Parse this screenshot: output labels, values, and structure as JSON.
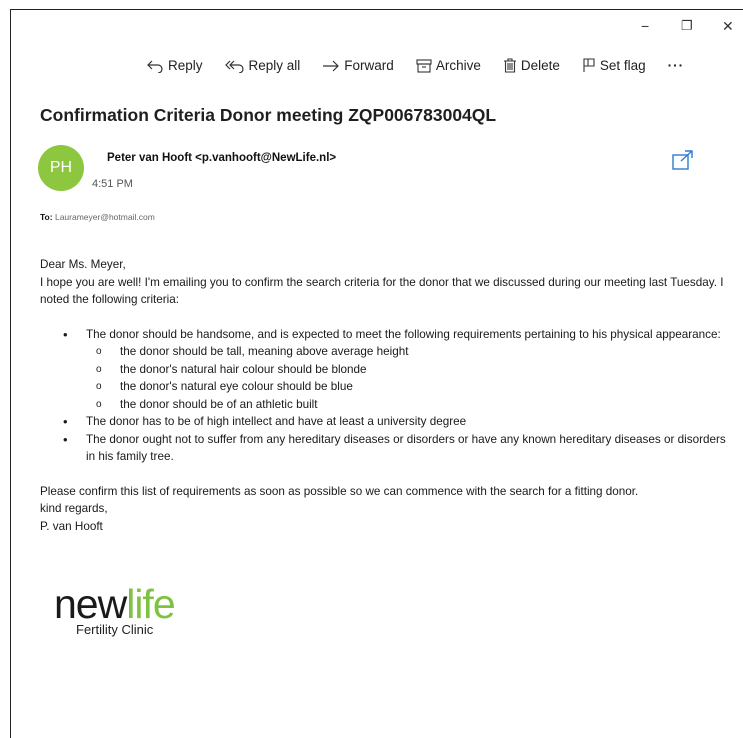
{
  "window_controls": {
    "minimize": "−",
    "restore": "❐",
    "close": "✕"
  },
  "toolbar": {
    "reply": "Reply",
    "reply_all": "Reply all",
    "forward": "Forward",
    "archive": "Archive",
    "delete": "Delete",
    "set_flag": "Set flag",
    "more": "···"
  },
  "email": {
    "subject": "Confirmation Criteria Donor meeting ZQP006783004QL",
    "avatar_initials": "PH",
    "avatar_color": "#8dc63f",
    "sender": "Peter van Hooft <p.vanhooft@NewLife.nl>",
    "time": "4:51 PM",
    "to_label": "To:",
    "to_address": "Laurameyer@hotmail.com",
    "greeting": "Dear Ms. Meyer,",
    "intro": "I hope you are well! I'm emailing you to confirm the search criteria for the donor that we discussed during our meeting last Tuesday. I noted the following criteria:",
    "criteria": [
      "The donor should be handsome, and is expected to meet the following requirements pertaining to his physical appearance:",
      "The donor has to be of high intellect and have at least a university degree",
      "The donor ought not to suffer from any hereditary diseases or disorders or have any known hereditary diseases or disorders in his family tree."
    ],
    "sub_criteria": [
      "the donor should be tall, meaning above average height",
      "the donor's natural hair colour should be blonde",
      "the donor's natural eye colour should be blue",
      "the donor should be of an athletic built"
    ],
    "closing": "Please confirm this list of requirements as soon as possible so we can commence with the search for a fitting donor.",
    "regards": "kind regards,",
    "signature": "P. van Hooft"
  },
  "logo": {
    "part1": "new",
    "part2": "life",
    "tagline": "Fertility Clinic",
    "accent_color": "#7fc241"
  },
  "icons": [
    "reply-icon",
    "reply-all-icon",
    "forward-icon",
    "archive-icon",
    "delete-icon",
    "flag-icon",
    "popout-icon"
  ]
}
